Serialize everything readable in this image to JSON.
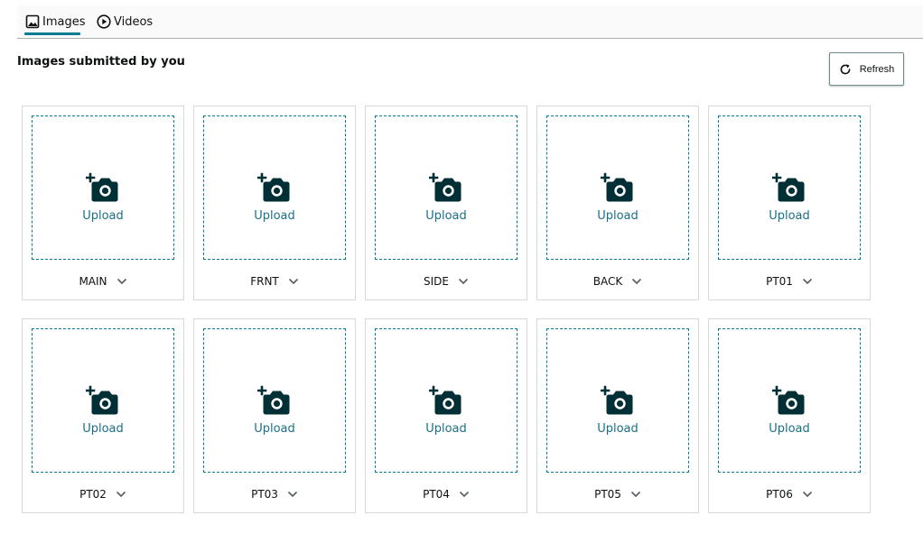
{
  "tabs": {
    "images_label": "Images",
    "videos_label": "Videos",
    "active": "images"
  },
  "section_title": "Images submitted by you",
  "refresh_label": "Refresh",
  "upload_label": "Upload",
  "slots": [
    "MAIN",
    "FRNT",
    "SIDE",
    "BACK",
    "PT01",
    "PT02",
    "PT03",
    "PT04",
    "PT05",
    "PT06"
  ],
  "icons": {
    "images_tab": "image-icon",
    "videos_tab": "play-circle-icon",
    "refresh": "refresh-icon",
    "upload": "add-camera-icon",
    "variant_dropdown": "chevron-down-icon"
  },
  "colors": {
    "accent": "#067d94",
    "upload_text": "#1a6f88",
    "icon_dark": "#002f36",
    "card_border": "#d5d9d9"
  }
}
